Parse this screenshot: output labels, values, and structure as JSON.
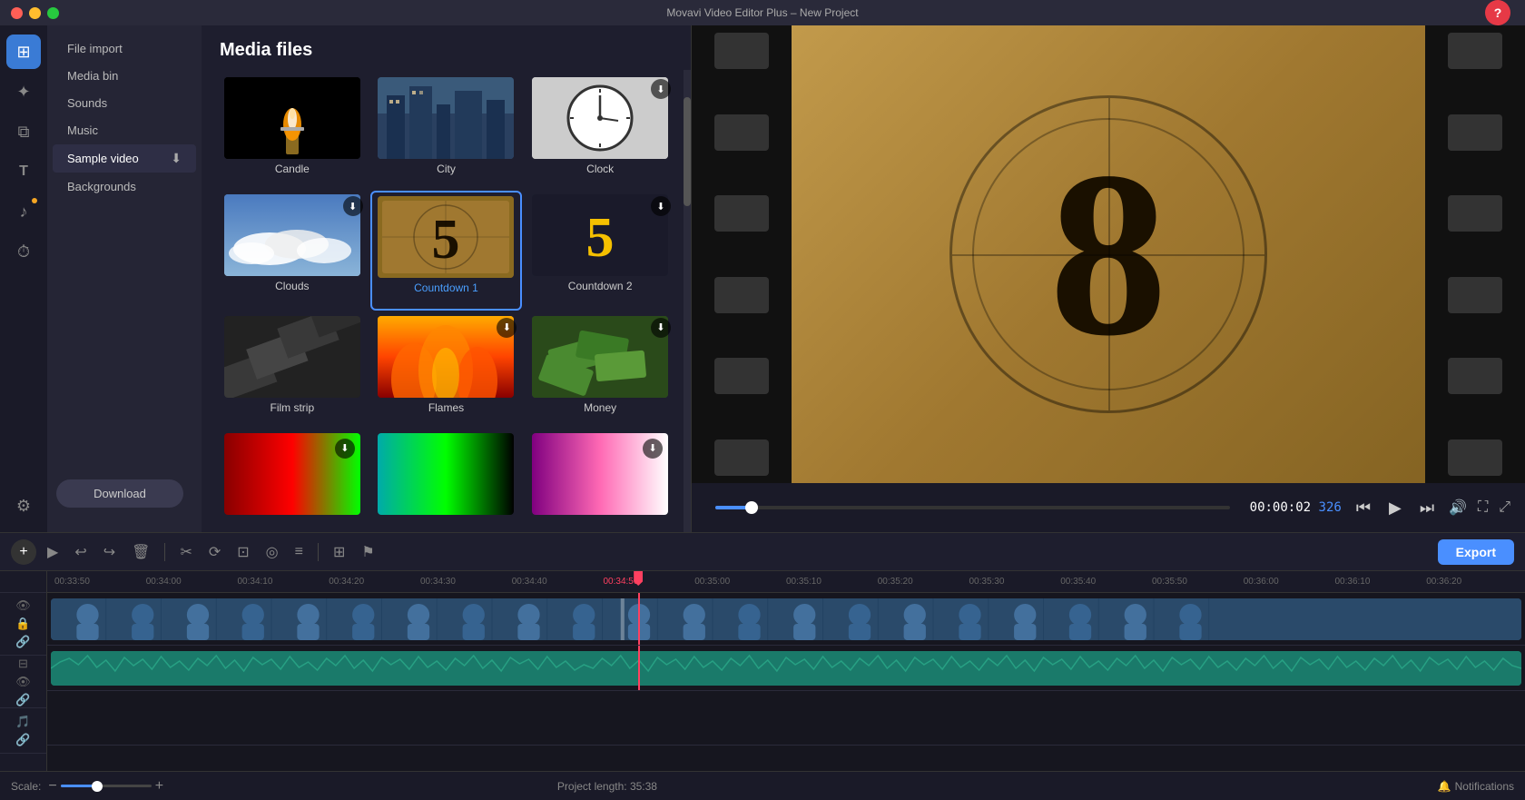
{
  "app": {
    "title": "Movavi Video Editor Plus – New Project"
  },
  "titlebar": {
    "title": "Movavi Video Editor Plus – New Project",
    "traffic_lights": [
      "red",
      "yellow",
      "green"
    ]
  },
  "sidebar_icons": [
    {
      "name": "media-icon",
      "symbol": "⊞",
      "active": true
    },
    {
      "name": "effects-icon",
      "symbol": "✦",
      "active": false
    },
    {
      "name": "transitions-icon",
      "symbol": "⧉",
      "active": false
    },
    {
      "name": "titles-icon",
      "symbol": "T",
      "active": false
    },
    {
      "name": "music-icon",
      "symbol": "♪",
      "active": false,
      "has_dot": true
    },
    {
      "name": "history-icon",
      "symbol": "⟳",
      "active": false
    },
    {
      "name": "tools-icon",
      "symbol": "⚙",
      "active": false
    }
  ],
  "nav": {
    "items": [
      {
        "label": "File import",
        "active": false
      },
      {
        "label": "Media bin",
        "active": false
      },
      {
        "label": "Sounds",
        "active": false
      },
      {
        "label": "Music",
        "active": false
      },
      {
        "label": "Sample video",
        "active": true
      },
      {
        "label": "Backgrounds",
        "active": false
      }
    ],
    "download_button": "Download"
  },
  "media_files": {
    "title": "Media files",
    "items": [
      {
        "id": "candle",
        "label": "Candle",
        "has_download": false,
        "selected": false,
        "thumb_type": "candle"
      },
      {
        "id": "city",
        "label": "City",
        "has_download": false,
        "selected": false,
        "thumb_type": "city"
      },
      {
        "id": "clock",
        "label": "Clock",
        "has_download": true,
        "selected": false,
        "thumb_type": "clock"
      },
      {
        "id": "clouds",
        "label": "Clouds",
        "has_download": true,
        "selected": false,
        "thumb_type": "clouds"
      },
      {
        "id": "countdown1",
        "label": "Countdown 1",
        "has_download": false,
        "selected": true,
        "thumb_type": "countdown1"
      },
      {
        "id": "countdown2",
        "label": "Countdown 2",
        "has_download": true,
        "selected": false,
        "thumb_type": "countdown2"
      },
      {
        "id": "filmstrip",
        "label": "Film strip",
        "has_download": false,
        "selected": false,
        "thumb_type": "filmstrip"
      },
      {
        "id": "flames",
        "label": "Flames",
        "has_download": true,
        "selected": false,
        "thumb_type": "flames"
      },
      {
        "id": "money",
        "label": "Money",
        "has_download": true,
        "selected": false,
        "thumb_type": "money"
      },
      {
        "id": "partial1",
        "label": "",
        "has_download": true,
        "selected": false,
        "thumb_type": "partial_red"
      },
      {
        "id": "partial2",
        "label": "",
        "has_download": false,
        "selected": false,
        "thumb_type": "partial_cyan"
      },
      {
        "id": "partial3",
        "label": "",
        "has_download": true,
        "selected": false,
        "thumb_type": "partial_pink"
      }
    ]
  },
  "preview": {
    "countdown_number": "8",
    "timecode": "00:00:02",
    "frame": "326",
    "progress_percent": 7
  },
  "timeline": {
    "ruler_marks": [
      "00:33:50",
      "00:34:00",
      "00:34:10",
      "00:34:20",
      "00:34:30",
      "00:34:40",
      "00:34:50",
      "00:35:00",
      "00:35:10",
      "00:35:20",
      "00:35:30",
      "00:35:40",
      "00:35:50",
      "00:36:00",
      "00:36:10",
      "00:36:20"
    ],
    "export_label": "Export",
    "add_track_symbol": "+",
    "project_length_label": "Project length:",
    "project_length_value": "35:38",
    "scale_label": "Scale:",
    "notifications_label": "Notifications"
  }
}
